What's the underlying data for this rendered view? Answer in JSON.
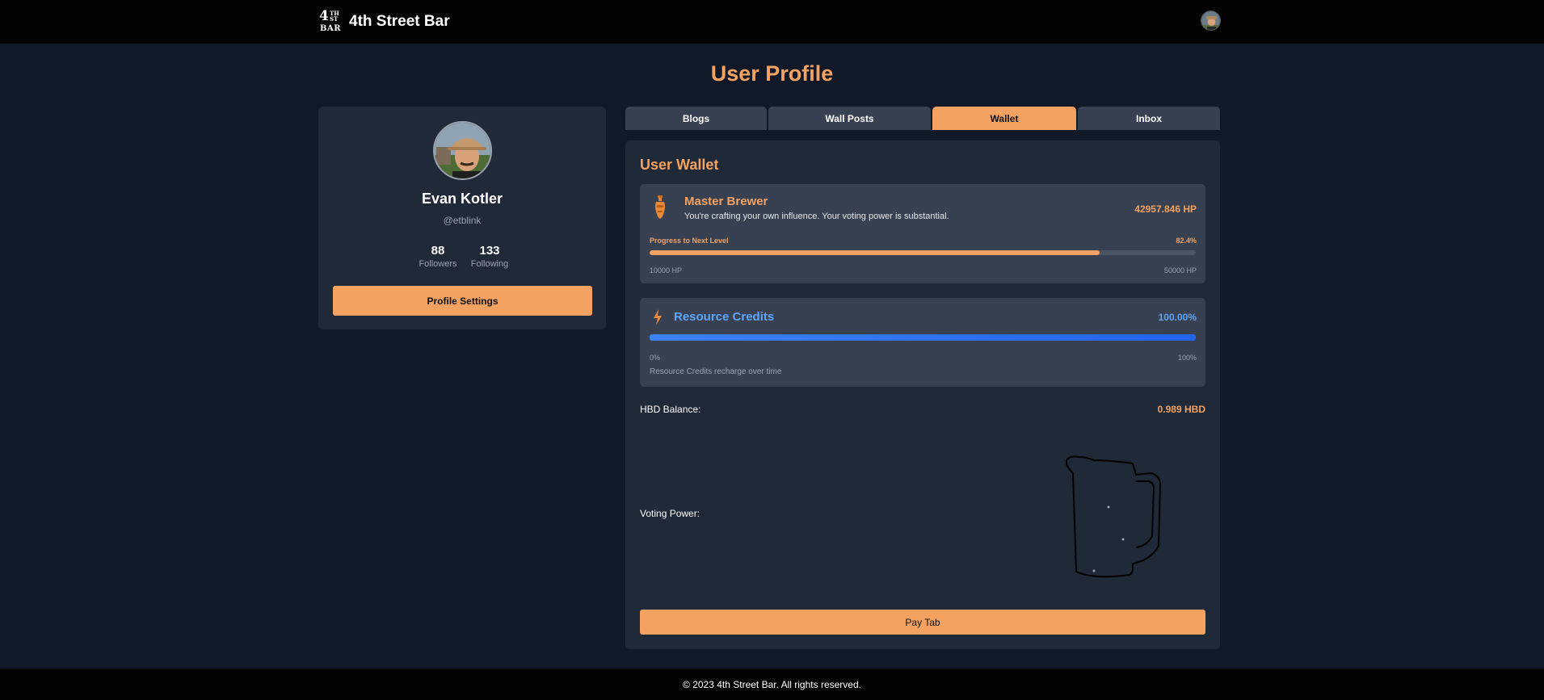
{
  "header": {
    "logo": {
      "line1": "4",
      "sup1": "TH",
      "sup2": "ST",
      "line2": "BAR"
    },
    "brand_name": "4th Street Bar",
    "avatar_icon": "user-avatar-icon"
  },
  "page_title": "User Profile",
  "profile": {
    "name": "Evan Kotler",
    "handle": "@etblink",
    "followers_count": "88",
    "followers_label": "Followers",
    "following_count": "133",
    "following_label": "Following",
    "settings_label": "Profile Settings"
  },
  "tabs": [
    {
      "label": "Blogs",
      "active": false
    },
    {
      "label": "Wall Posts",
      "active": false
    },
    {
      "label": "Wallet",
      "active": true
    },
    {
      "label": "Inbox",
      "active": false
    }
  ],
  "wallet": {
    "title": "User Wallet",
    "level": {
      "icon": "amphora-icon",
      "title": "Master Brewer",
      "description": "You're crafting your own influence. Your voting power is substantial.",
      "hp": "42957.846 HP",
      "progress_label": "Progress to Next Level",
      "progress_pct_text": "82.4%",
      "progress_fraction": 0.824,
      "range_min": "10000 HP",
      "range_max": "50000 HP"
    },
    "resource_credits": {
      "icon": "lightning-bolt-icon",
      "title": "Resource Credits",
      "pct_text": "100.00%",
      "fraction": 1.0,
      "range_min": "0%",
      "range_max": "100%",
      "note": "Resource Credits recharge over time"
    },
    "hbd_label": "HBD Balance:",
    "hbd_value": "0.989 HBD",
    "voting_power_label": "Voting Power:",
    "voting_power_icon": "beer-pitcher-icon",
    "pay_label": "Pay Tab"
  },
  "footer": {
    "text": "© 2023 4th Street Bar. All rights reserved."
  },
  "colors": {
    "accent": "#f4a261",
    "blue": "#3b82f6",
    "background": "#111827",
    "card": "#1f2937"
  }
}
